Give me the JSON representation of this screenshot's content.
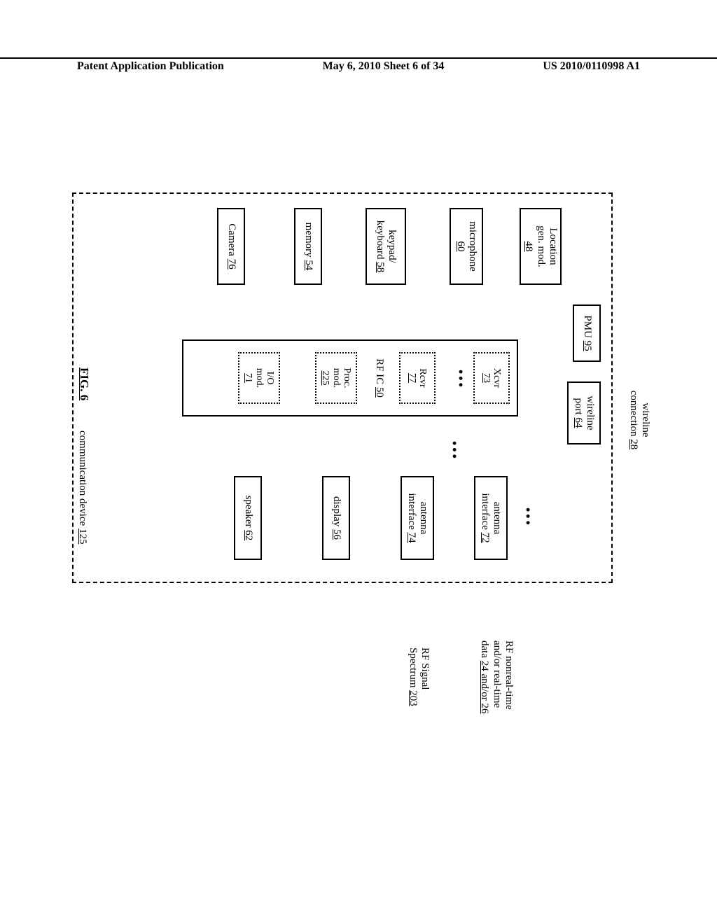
{
  "header": {
    "left": "Patent Application Publication",
    "center": "May 6, 2010  Sheet 6 of 34",
    "right": "US 2010/0110998 A1"
  },
  "labels": {
    "wireline_conn": "wireline",
    "wireline_conn2": "connection",
    "wireline_conn_ref": "28",
    "rf_data1": "RF nonreal-time",
    "rf_data2": "and/or real-time",
    "rf_data3": "data",
    "rf_data_ref": "24 and/or 26",
    "rf_sig1": "RF Signal",
    "rf_sig2": "Spectrum",
    "rf_sig_ref": "203",
    "device": "communication device",
    "device_ref": "125",
    "fig": "FIG. 6"
  },
  "boxes": {
    "pmu": {
      "t": "PMU",
      "r": "95"
    },
    "wport": {
      "t": "wireline",
      "t2": "port",
      "r": "64"
    },
    "loc": {
      "t": "Location",
      "t2": "gen. mod.",
      "r": "48"
    },
    "mic": {
      "t": "microphone",
      "r": "60"
    },
    "key": {
      "t": "keypad/",
      "t2": "keyboard",
      "r": "58"
    },
    "mem": {
      "t": "memory",
      "r": "54"
    },
    "cam": {
      "t": "Camera",
      "r": "76"
    },
    "ant1": {
      "t": "antenna",
      "t2": "interface",
      "r": "72"
    },
    "ant2": {
      "t": "antenna",
      "t2": "interface",
      "r": "74"
    },
    "disp": {
      "t": "display",
      "r": "56"
    },
    "spk": {
      "t": "speaker",
      "r": "62"
    },
    "rfic": {
      "t": "RF IC",
      "r": "50"
    },
    "xcvr": {
      "t": "Xcvr",
      "r": "73"
    },
    "rcvr": {
      "t": "Rcvr",
      "r": "77"
    },
    "proc": {
      "t": "Proc.",
      "t2": "mod.",
      "r": "225"
    },
    "io": {
      "t": "I/O",
      "t2": "mod.",
      "r": "71"
    }
  }
}
